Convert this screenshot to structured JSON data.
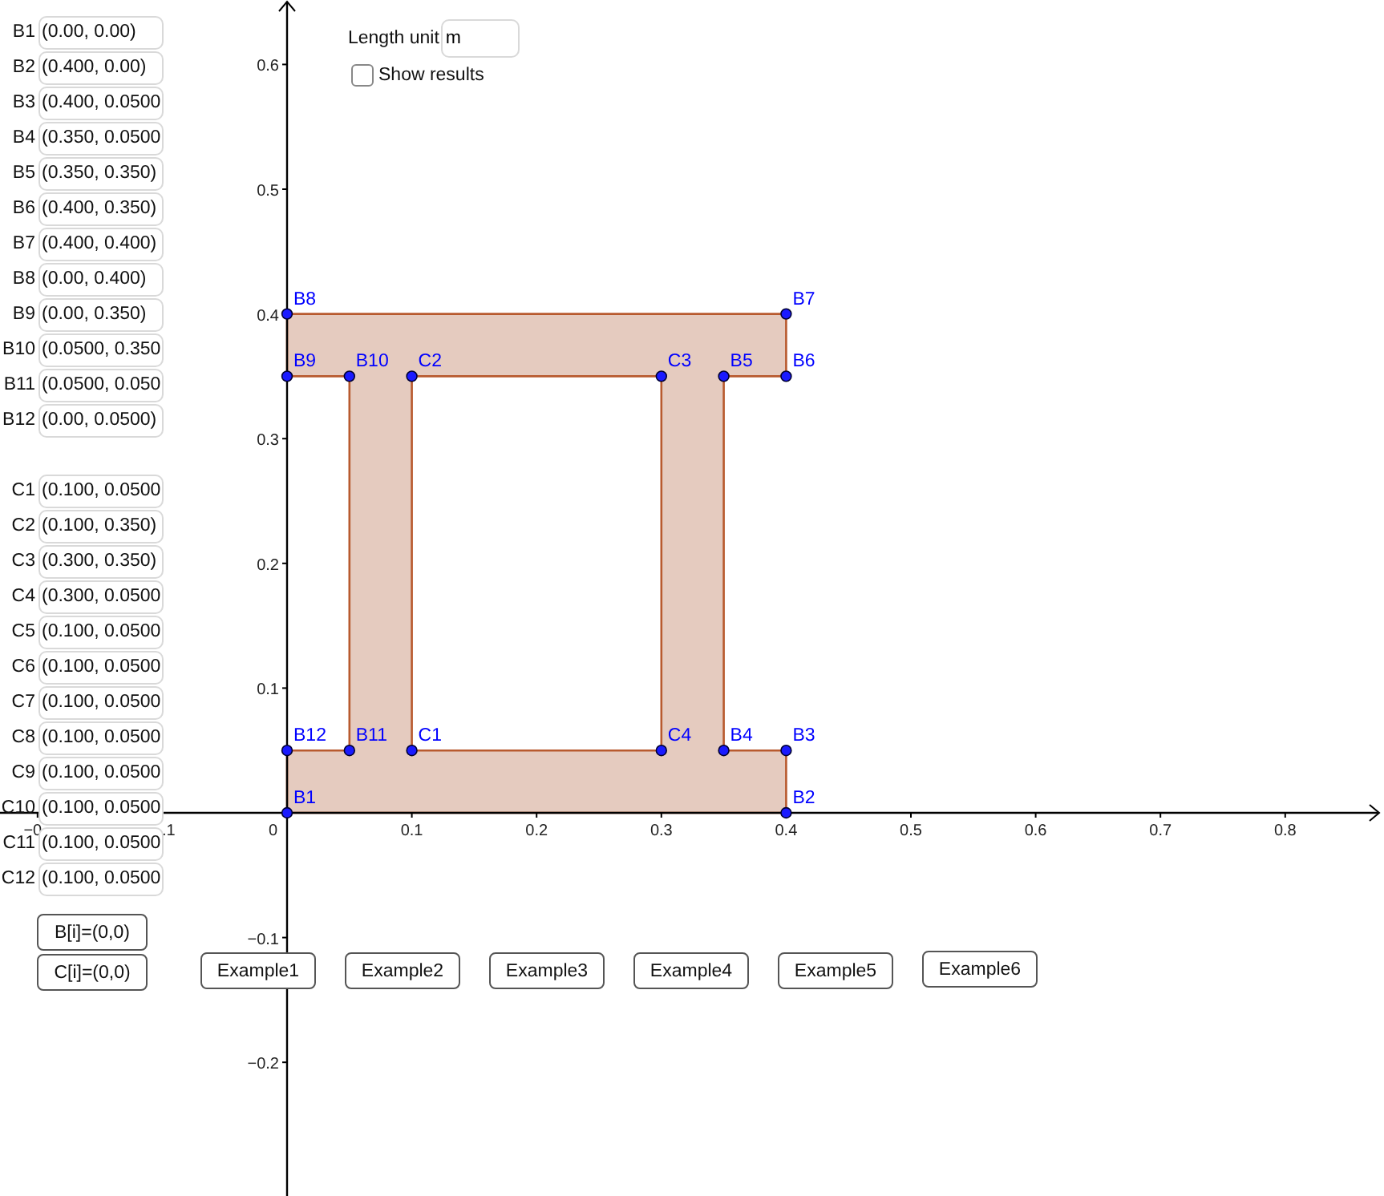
{
  "field_groups": [
    {
      "kind": "solid",
      "fields": [
        {
          "label": "B1",
          "value": "(0.00, 0.00)"
        },
        {
          "label": "B2",
          "value": "(0.400, 0.00)"
        },
        {
          "label": "B3",
          "value": "(0.400, 0.0500"
        },
        {
          "label": "B4",
          "value": "(0.350, 0.0500"
        },
        {
          "label": "B5",
          "value": "(0.350, 0.350)"
        },
        {
          "label": "B6",
          "value": "(0.400, 0.350)"
        },
        {
          "label": "B7",
          "value": "(0.400, 0.400)"
        },
        {
          "label": "B8",
          "value": "(0.00, 0.400)"
        },
        {
          "label": "B9",
          "value": "(0.00, 0.350)"
        },
        {
          "label": "B10",
          "value": "(0.0500, 0.350"
        },
        {
          "label": "B11",
          "value": "(0.0500, 0.050"
        },
        {
          "label": "B12",
          "value": "(0.00, 0.0500)"
        }
      ]
    },
    {
      "kind": "hole",
      "fields": [
        {
          "label": "C1",
          "value": "(0.100, 0.0500"
        },
        {
          "label": "C2",
          "value": "(0.100, 0.350)"
        },
        {
          "label": "C3",
          "value": "(0.300, 0.350)"
        },
        {
          "label": "C4",
          "value": "(0.300, 0.0500"
        },
        {
          "label": "C5",
          "value": "(0.100, 0.0500"
        },
        {
          "label": "C6",
          "value": "(0.100, 0.0500"
        },
        {
          "label": "C7",
          "value": "(0.100, 0.0500"
        },
        {
          "label": "C8",
          "value": "(0.100, 0.0500"
        },
        {
          "label": "C9",
          "value": "(0.100, 0.0500"
        },
        {
          "label": "C10",
          "value": "(0.100, 0.0500"
        },
        {
          "label": "C11",
          "value": "(0.100, 0.0500"
        },
        {
          "label": "C12",
          "value": "(0.100, 0.0500"
        }
      ]
    }
  ],
  "reset_buttons": [
    "B[i]=(0,0)",
    "C[i]=(0,0)"
  ],
  "length_unit": {
    "label": "Length unit",
    "value": "m"
  },
  "show_results": {
    "label": "Show results",
    "checked": false
  },
  "example_buttons": [
    "Example1",
    "Example2",
    "Example3",
    "Example4",
    "Example5",
    "Example6"
  ],
  "plot": {
    "xtick_labels": [
      "−0",
      ".1",
      "0",
      "0.1",
      "0.2",
      "0.3",
      "0.4",
      "0.5",
      "0.6",
      "0.7",
      "0.8"
    ],
    "ytick_labels": [
      "0.6",
      "0.5",
      "0.4",
      "0.3",
      "0.2",
      "0.1",
      "−0.1",
      "−0.2"
    ],
    "point_labels": [
      "B8",
      "B7",
      "B9",
      "B10",
      "C2",
      "C3",
      "B5",
      "B6",
      "B12",
      "B11",
      "C1",
      "C4",
      "B4",
      "B3",
      "B1",
      "B2"
    ]
  }
}
